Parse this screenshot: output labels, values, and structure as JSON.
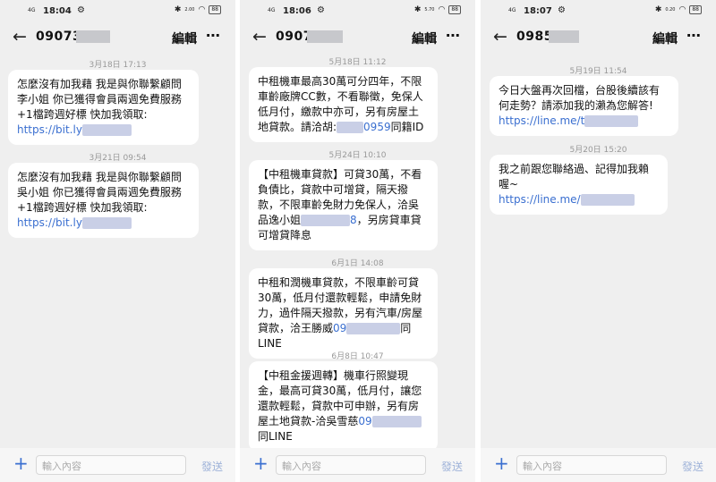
{
  "screens": [
    {
      "status": {
        "signal": "4G",
        "time": "18:04",
        "speed": "2.00",
        "battery": "88"
      },
      "header": {
        "phone": "09073",
        "edit_label": "編輯",
        "more_label": "⋯"
      },
      "messages": [
        {
          "date": "3月18日 17:13",
          "text": "怎麼沒有加我藉 我是與你聯繫顧問李小姐 你已獲得會員兩週免費服務+1檔跨週好標 快加我領取:",
          "link": "https://bit.ly"
        },
        {
          "date": "3月21日 09:54",
          "text": "怎麼沒有加我藉 我是與你聯繫顧問吳小姐 你已獲得會員兩週免費服務+1檔跨週好標 快加我領取:",
          "link": "https://bit.ly"
        }
      ],
      "input": {
        "placeholder": "輸入內容",
        "send_label": "發送"
      }
    },
    {
      "status": {
        "signal": "4G",
        "time": "18:06",
        "speed": "5.70",
        "battery": "88"
      },
      "header": {
        "phone": "0907",
        "edit_label": "編輯",
        "more_label": "⋯"
      },
      "messages": [
        {
          "date": "5月18日 11:12",
          "text": "中租機車最高30萬可分四年，不限車齡廠牌CC數，不看聯徵，免保人低月付，繳款中亦可，另有房屋土地貸款。請洽胡:",
          "tail": "0959",
          "tail2": "同籍ID"
        },
        {
          "date": "5月24日 10:10",
          "text": "【中租機車貸款】可貸30萬，不看負債比，貸款中可增貸，隔天撥款，不限車齡免財力免保人，洽吳品逸小姐",
          "tail": "8",
          "tail2": "，另房貸車貸可增貸降息"
        },
        {
          "date": "6月1日 14:08",
          "text": "中租和潤機車貸款，不限車齡可貸30萬，低月付還款輕鬆，申請免財力，過件隔天撥款，另有汽車/房屋貸款，洽王勝威",
          "tail": "09",
          "tail2": "同LINE"
        },
        {
          "date": "6月8日 10:47",
          "text": "【中租金援週轉】機車行照變現金，最高可貸30萬，低月付，讓您還款輕鬆，貸款中可申辦，另有房屋土地貸款-洽吳雪慈",
          "tail": "09",
          "tail2": "同LINE"
        }
      ],
      "input": {
        "placeholder": "輸入內容",
        "send_label": "發送"
      }
    },
    {
      "status": {
        "signal": "4G",
        "time": "18:07",
        "speed": "0.20",
        "battery": "88"
      },
      "header": {
        "phone": "0985",
        "edit_label": "編輯",
        "more_label": "⋯"
      },
      "messages": [
        {
          "date": "5月19日 11:54",
          "text": "今日大盤再次回檔，台股後續該有何走勢？請添加我的瀨為您解答!",
          "link": "https://line.me/t"
        },
        {
          "date": "5月20日 15:20",
          "text": "我之前跟您聯絡過、記得加我賴喔~",
          "link": "https://line.me/"
        }
      ],
      "input": {
        "placeholder": "輸入內容",
        "send_label": "發送"
      }
    }
  ]
}
